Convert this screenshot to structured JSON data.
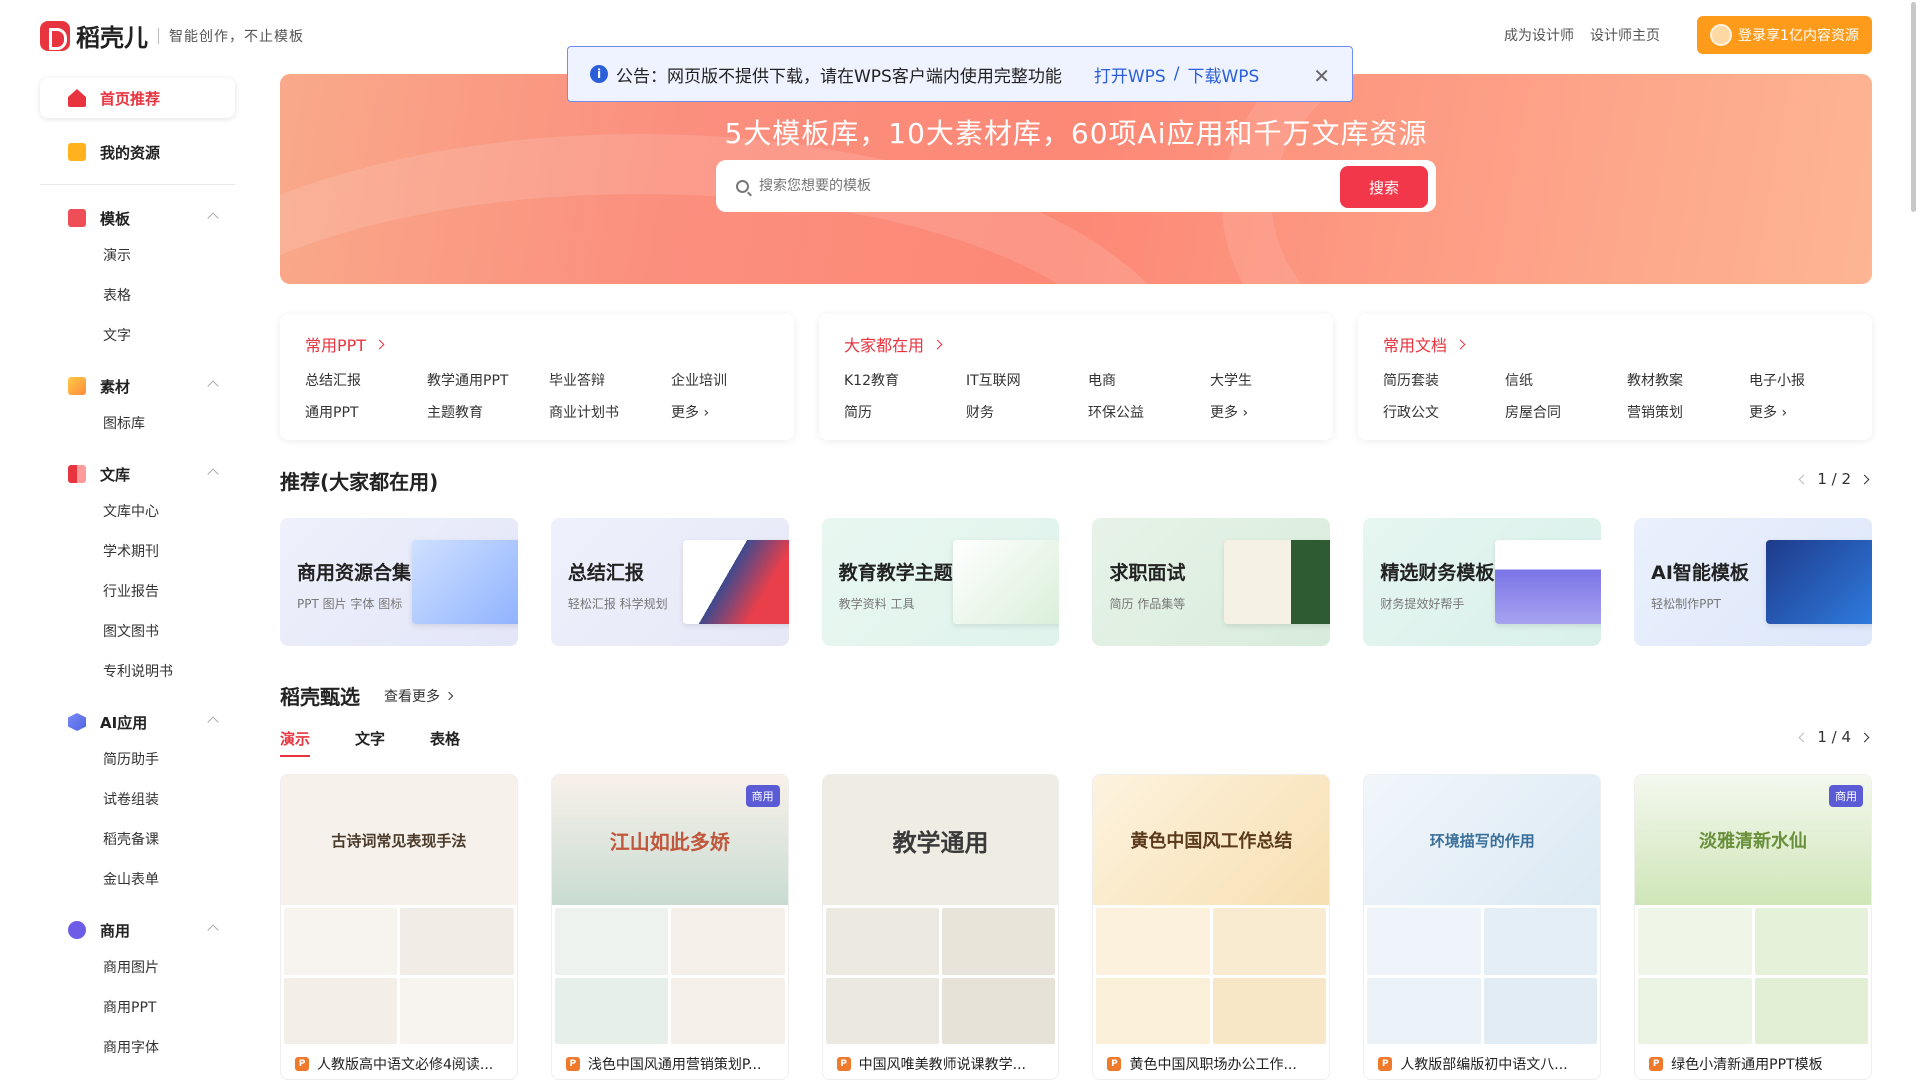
{
  "header": {
    "logo_name": "稻壳儿",
    "slogan": "智能创作，不止模板",
    "links": [
      "成为设计师",
      "设计师主页"
    ],
    "login_label": "登录享1亿内容资源"
  },
  "notice": {
    "text": "公告：网页版不提供下载，请在WPS客户端内使用完整功能",
    "open_link": "打开WPS",
    "slash": "/",
    "download_link": "下载WPS"
  },
  "sidebar": {
    "home": "首页推荐",
    "resources": "我的资源",
    "groups": [
      {
        "title": "模板",
        "items": [
          "演示",
          "表格",
          "文字"
        ]
      },
      {
        "title": "素材",
        "items": [
          "图标库"
        ]
      },
      {
        "title": "文库",
        "items": [
          "文库中心",
          "学术期刊",
          "行业报告",
          "图文图书",
          "专利说明书"
        ]
      },
      {
        "title": "AI应用",
        "items": [
          "简历助手",
          "试卷组装",
          "稻壳备课",
          "金山表单"
        ]
      },
      {
        "title": "商用",
        "items": [
          "商用图片",
          "商用PPT",
          "商用字体"
        ]
      }
    ]
  },
  "banner": {
    "title": "5大模板库，10大素材库，60项Ai应用和千万文库资源",
    "search_placeholder": "搜索您想要的模板",
    "search_button": "搜索"
  },
  "categories": [
    {
      "title": "常用PPT",
      "items": [
        "总结汇报",
        "教学通用PPT",
        "毕业答辩",
        "企业培训",
        "通用PPT",
        "主题教育",
        "商业计划书",
        "更多"
      ]
    },
    {
      "title": "大家都在用",
      "items": [
        "K12教育",
        "IT互联网",
        "电商",
        "大学生",
        "简历",
        "财务",
        "环保公益",
        "更多"
      ]
    },
    {
      "title": "常用文档",
      "items": [
        "简历套装",
        "信纸",
        "教材教案",
        "电子小报",
        "行政公文",
        "房屋合同",
        "营销策划",
        "更多"
      ]
    }
  ],
  "recommend": {
    "title": "推荐(大家都在用)",
    "pager": "1 / 2",
    "cards": [
      {
        "title": "商用资源合集",
        "sub": "PPT 图片 字体 图标"
      },
      {
        "title": "总结汇报",
        "sub": "轻松汇报 科学规划"
      },
      {
        "title": "教育教学主题",
        "sub": "教学资料 工具"
      },
      {
        "title": "求职面试",
        "sub": "简历 作品集等"
      },
      {
        "title": "精选财务模板",
        "sub": "财务提效好帮手"
      },
      {
        "title": "AI智能模板",
        "sub": "轻松制作PPT"
      }
    ]
  },
  "featured": {
    "title": "稻壳甄选",
    "more": "查看更多",
    "pager": "1 / 4",
    "tabs": [
      "演示",
      "文字",
      "表格"
    ],
    "badge": "商用",
    "templates": [
      {
        "name": "人教版高中语文必修4阅读...",
        "cover": "古诗词常见表现手法"
      },
      {
        "name": "浅色中国风通用营销策划P...",
        "cover": "江山如此多娇"
      },
      {
        "name": "中国风唯美教师说课教学...",
        "cover": "教学通用"
      },
      {
        "name": "黄色中国风职场办公工作...",
        "cover": "黄色中国风工作总结"
      },
      {
        "name": "人教版部编版初中语文八...",
        "cover": "环境描写的作用"
      },
      {
        "name": "绿色小清新通用PPT模板",
        "cover": "淡雅清新水仙"
      }
    ]
  },
  "colors": {
    "accent": "#e8343f",
    "login": "#ff9b1a",
    "notice_link": "#2b5fd9"
  }
}
